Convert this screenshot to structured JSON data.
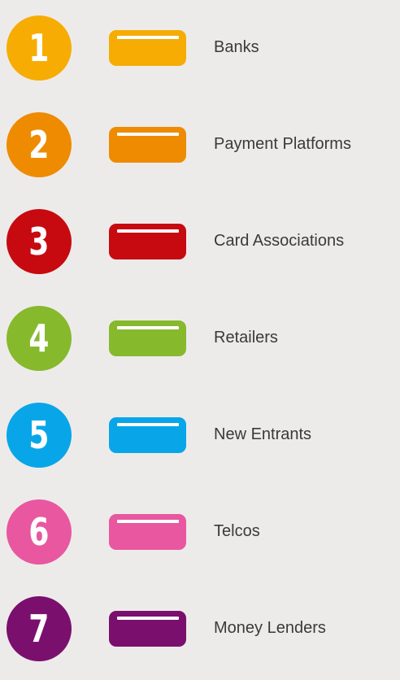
{
  "items": [
    {
      "number": "1",
      "label": "Banks",
      "color": "#f6ac02"
    },
    {
      "number": "2",
      "label": "Payment Platforms",
      "color": "#ee8b00"
    },
    {
      "number": "3",
      "label": "Card Associations",
      "color": "#c60a10"
    },
    {
      "number": "4",
      "label": "Retailers",
      "color": "#86b92c"
    },
    {
      "number": "5",
      "label": "New Entrants",
      "color": "#08a6e8"
    },
    {
      "number": "6",
      "label": "Telcos",
      "color": "#e8579f"
    },
    {
      "number": "7",
      "label": "Money Lenders",
      "color": "#7a0f6e"
    }
  ],
  "card_icon": "credit-card-icon",
  "badge_icon": "number-circle-icon"
}
